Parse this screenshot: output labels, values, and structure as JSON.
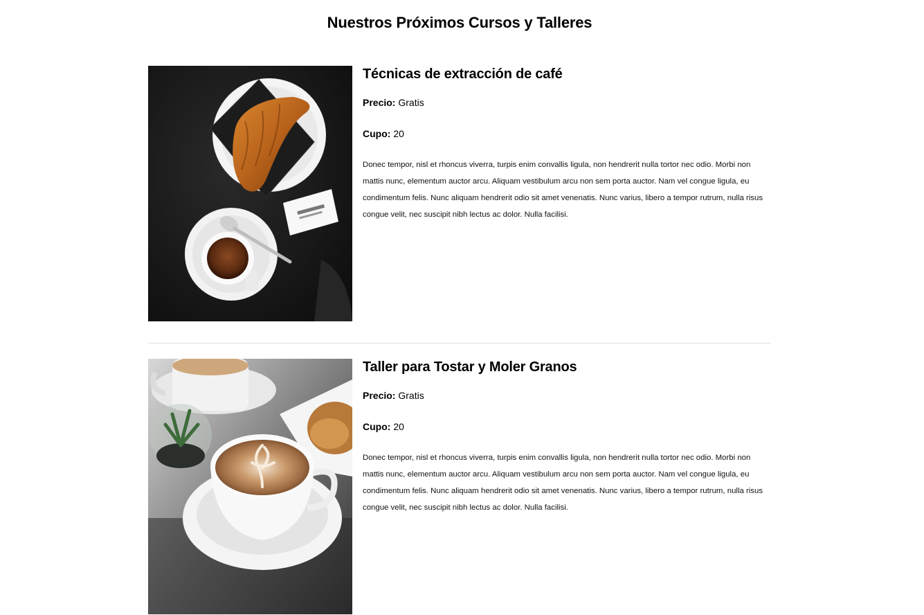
{
  "page": {
    "title": "Nuestros Próximos Cursos y Talleres"
  },
  "courses": [
    {
      "title": "Técnicas de extracción de café",
      "price_label": "Precio:",
      "price_value": "Gratis",
      "spots_label": "Cupo:",
      "spots_value": "20",
      "description": "Donec tempor, nisl et rhoncus viverra, turpis enim convallis ligula, non hendrerit nulla tortor nec odio. Morbi non mattis nunc, elementum auctor arcu. Aliquam vestibulum arcu non sem porta auctor. Nam vel congue ligula, eu condimentum felis. Nunc aliquam hendrerit odio sit amet venenatis. Nunc varius, libero a tempor rutrum, nulla risus congue velit, nec suscipit nibh lectus ac dolor. Nulla facilisi.",
      "image": "croissant-espresso-photo"
    },
    {
      "title": "Taller para Tostar y Moler Granos",
      "price_label": "Precio:",
      "price_value": "Gratis",
      "spots_label": "Cupo:",
      "spots_value": "20",
      "description": "Donec tempor, nisl et rhoncus viverra, turpis enim convallis ligula, non hendrerit nulla tortor nec odio. Morbi non mattis nunc, elementum auctor arcu. Aliquam vestibulum arcu non sem porta auctor. Nam vel congue ligula, eu condimentum felis. Nunc aliquam hendrerit odio sit amet venenatis. Nunc varius, libero a tempor rutrum, nulla risus congue velit, nec suscipit nibh lectus ac dolor. Nulla facilisi.",
      "image": "latte-art-cups-photo"
    }
  ]
}
